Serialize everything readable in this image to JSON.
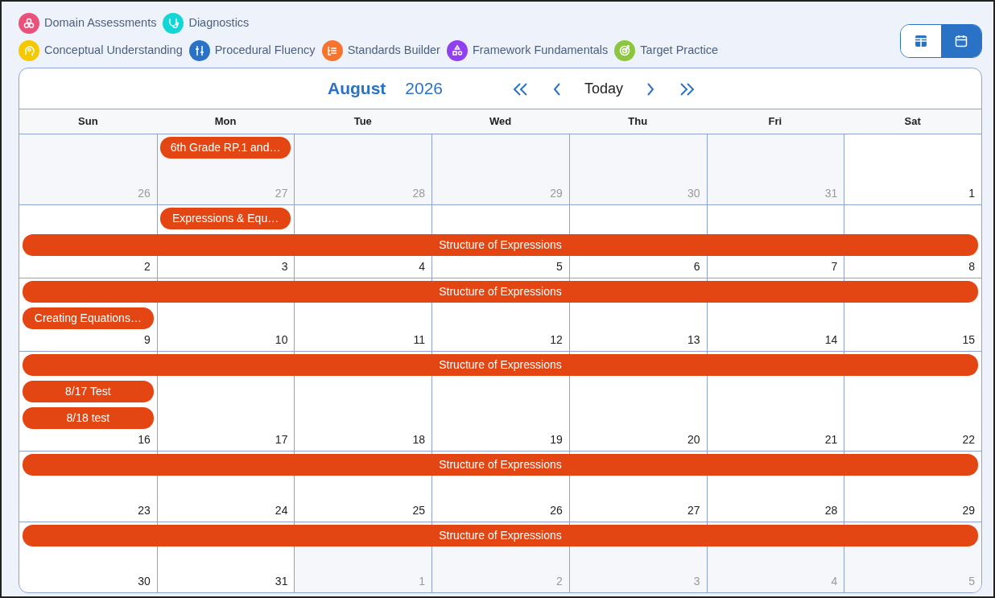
{
  "legend": [
    {
      "label": "Domain Assessments",
      "color": "#e9507a"
    },
    {
      "label": "Diagnostics",
      "color": "#12d6d6"
    },
    {
      "label": "Conceptual Understanding",
      "color": "#f5c800"
    },
    {
      "label": "Procedural Fluency",
      "color": "#2a72c6"
    },
    {
      "label": "Standards Builder",
      "color": "#f7742f"
    },
    {
      "label": "Framework Fundamentals",
      "color": "#9140f0"
    },
    {
      "label": "Target Practice",
      "color": "#8cc63f"
    }
  ],
  "view_toggle": [
    {
      "selected": false
    },
    {
      "selected": true
    }
  ],
  "calendar": {
    "month": "August",
    "year": "2026",
    "today": "Today",
    "weekdays": [
      "Sun",
      "Mon",
      "Tue",
      "Wed",
      "Thu",
      "Fri",
      "Sat"
    ],
    "weeks": [
      {
        "rows": [
          {
            "kind": "day_events"
          }
        ],
        "days": [
          {
            "number": "26",
            "outside": true
          },
          {
            "number": "27",
            "outside": true,
            "events": [
              "6th Grade RP.1 and…"
            ]
          },
          {
            "number": "28",
            "outside": true
          },
          {
            "number": "29",
            "outside": true
          },
          {
            "number": "30",
            "outside": true
          },
          {
            "number": "31",
            "outside": true
          },
          {
            "number": "1",
            "outside": false
          }
        ]
      },
      {
        "rows": [
          {
            "kind": "day_events"
          },
          {
            "kind": "banner",
            "label": "Structure of Expressions"
          }
        ],
        "days": [
          {
            "number": "2",
            "outside": false
          },
          {
            "number": "3",
            "outside": false,
            "events": [
              "Expressions & Equ…"
            ]
          },
          {
            "number": "4",
            "outside": false
          },
          {
            "number": "5",
            "outside": false
          },
          {
            "number": "6",
            "outside": false
          },
          {
            "number": "7",
            "outside": false
          },
          {
            "number": "8",
            "outside": false
          }
        ]
      },
      {
        "rows": [
          {
            "kind": "banner",
            "label": "Structure of Expressions"
          },
          {
            "kind": "day_events"
          }
        ],
        "days": [
          {
            "number": "9",
            "outside": false,
            "events": [
              "Creating Equations…"
            ]
          },
          {
            "number": "10",
            "outside": false
          },
          {
            "number": "11",
            "outside": false
          },
          {
            "number": "12",
            "outside": false
          },
          {
            "number": "13",
            "outside": false
          },
          {
            "number": "14",
            "outside": false
          },
          {
            "number": "15",
            "outside": false
          }
        ]
      },
      {
        "rows": [
          {
            "kind": "banner",
            "label": "Structure of Expressions"
          },
          {
            "kind": "day_events"
          }
        ],
        "days": [
          {
            "number": "16",
            "outside": false,
            "events": [
              "8/17 Test",
              "8/18 test"
            ]
          },
          {
            "number": "17",
            "outside": false
          },
          {
            "number": "18",
            "outside": false
          },
          {
            "number": "19",
            "outside": false
          },
          {
            "number": "20",
            "outside": false
          },
          {
            "number": "21",
            "outside": false
          },
          {
            "number": "22",
            "outside": false
          }
        ]
      },
      {
        "rows": [
          {
            "kind": "banner",
            "label": "Structure of Expressions"
          }
        ],
        "days": [
          {
            "number": "23",
            "outside": false
          },
          {
            "number": "24",
            "outside": false
          },
          {
            "number": "25",
            "outside": false
          },
          {
            "number": "26",
            "outside": false
          },
          {
            "number": "27",
            "outside": false
          },
          {
            "number": "28",
            "outside": false
          },
          {
            "number": "29",
            "outside": false
          }
        ]
      },
      {
        "rows": [
          {
            "kind": "banner",
            "label": "Structure of Expressions"
          }
        ],
        "days": [
          {
            "number": "30",
            "outside": false
          },
          {
            "number": "31",
            "outside": false
          },
          {
            "number": "1",
            "outside": true
          },
          {
            "number": "2",
            "outside": true
          },
          {
            "number": "3",
            "outside": true
          },
          {
            "number": "4",
            "outside": true
          },
          {
            "number": "5",
            "outside": true
          }
        ]
      }
    ]
  }
}
